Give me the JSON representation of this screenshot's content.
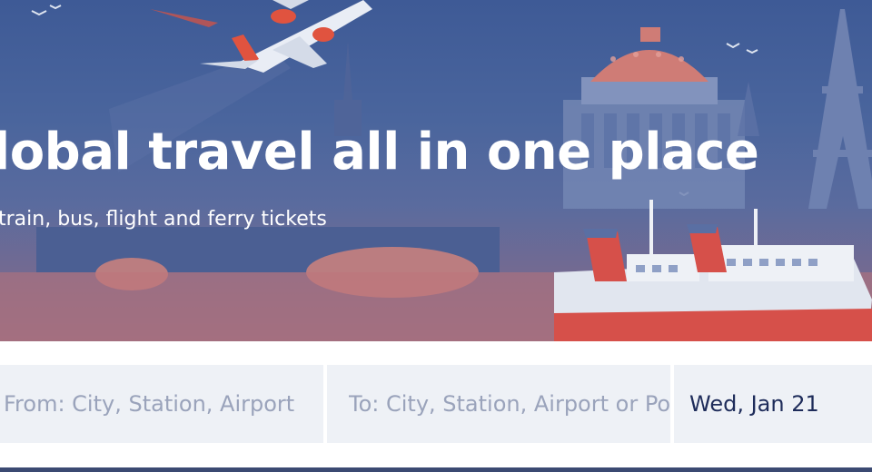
{
  "hero": {
    "title": "lobal travel all in one place",
    "subtitle": "train, bus, flight and ferry tickets"
  },
  "search": {
    "from_placeholder": "From: City, Station, Airport",
    "to_placeholder": "To: City, Station, Airport or Port",
    "date_value": "Wed, Jan 21"
  },
  "colors": {
    "hero_blue": "#4a659d",
    "field_bg": "#eef1f6",
    "text_dark": "#1e2c5a",
    "placeholder": "#9aa3bb",
    "bottom_bar": "#3b4a72"
  },
  "icons": {
    "airplane": "airplane-illustration",
    "ship": "ferry-illustration",
    "dome": "domed-building-illustration",
    "tower": "eiffel-tower-illustration",
    "bridge": "bridge-illustration",
    "birds": "birds-illustration"
  }
}
